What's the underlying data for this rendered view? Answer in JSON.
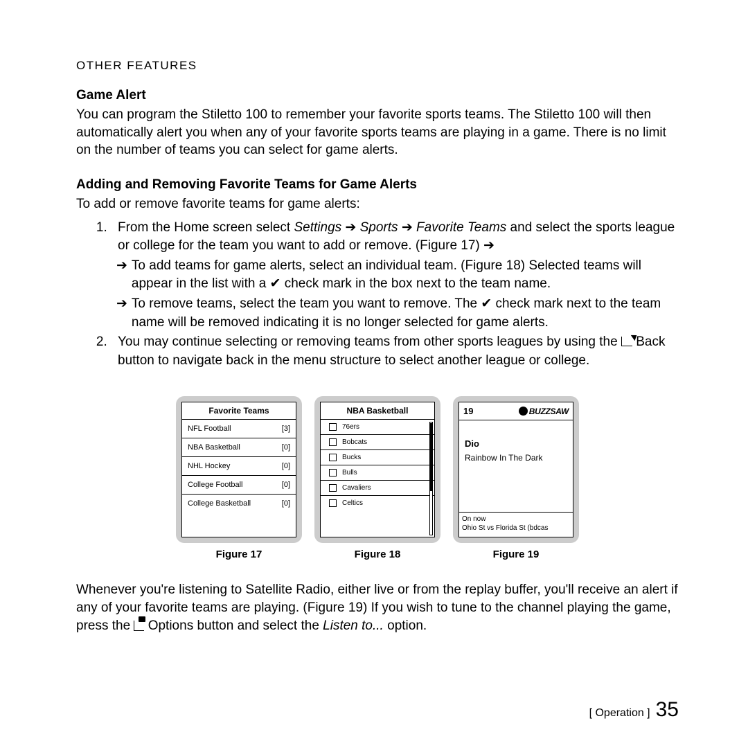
{
  "header": "OTHER FEATURES",
  "game_alert_title": "Game Alert",
  "game_alert_body": "You can program the Stiletto 100 to remember your favorite sports teams. The Stiletto 100 will then automatically alert you when any of your favorite sports teams are playing in a game. There is no limit on the number of teams you can select for game alerts.",
  "add_remove_title": "Adding and Removing Favorite Teams for Game Alerts",
  "add_remove_intro": "To add or remove favorite teams for game alerts:",
  "step1_a": "From the Home screen select ",
  "step1_settings": "Settings",
  "step1_sports": "Sports",
  "step1_favteams": "Favorite Teams",
  "step1_b": " and select the sports league or college for the team you want to add or remove. (Figure 17) ",
  "step1_bullet1": "To add teams for game alerts, select an individual team. (Figure 18) Selected teams will appear in the list with a ✔ check mark in the box next to the team name.",
  "step1_bullet2": "To remove teams, select the team you want to remove. The ✔ check mark next to the team name will be removed indicating it is no longer selected for game alerts.",
  "step2": "You may continue selecting or removing teams from other sports leagues by using the ",
  "step2_back": " Back button to navigate back in the menu structure to select another league or college.",
  "fig17_title": "Favorite Teams",
  "fig17_rows": [
    {
      "name": "NFL Football",
      "count": "[3]"
    },
    {
      "name": "NBA Basketball",
      "count": "[0]"
    },
    {
      "name": "NHL Hockey",
      "count": "[0]"
    },
    {
      "name": "College Football",
      "count": "[0]"
    },
    {
      "name": "College Basketball",
      "count": "[0]"
    }
  ],
  "fig18_title": "NBA Basketball",
  "fig18_teams": [
    "76ers",
    "Bobcats",
    "Bucks",
    "Bulls",
    "Cavaliers",
    "Celtics"
  ],
  "fig19": {
    "channel": "19",
    "brand": "BUZZSAW",
    "artist": "Dio",
    "track": "Rainbow In The Dark",
    "status": "On now",
    "game": "Ohio St vs Florida St (bdcas"
  },
  "fig17_cap": "Figure 17",
  "fig18_cap": "Figure 18",
  "fig19_cap": "Figure 19",
  "closing_a": "Whenever you're listening to Satellite Radio, either live or from the replay buffer, you'll receive an alert if any of your favorite teams are playing. (Figure 19) If you wish to tune to the channel playing the game, press the ",
  "closing_b": " Options button and select the ",
  "closing_listen": "Listen to...",
  "closing_c": " option.",
  "footer_label": "Operation",
  "page_num": "35",
  "arrow": "➔",
  "check": "✔"
}
